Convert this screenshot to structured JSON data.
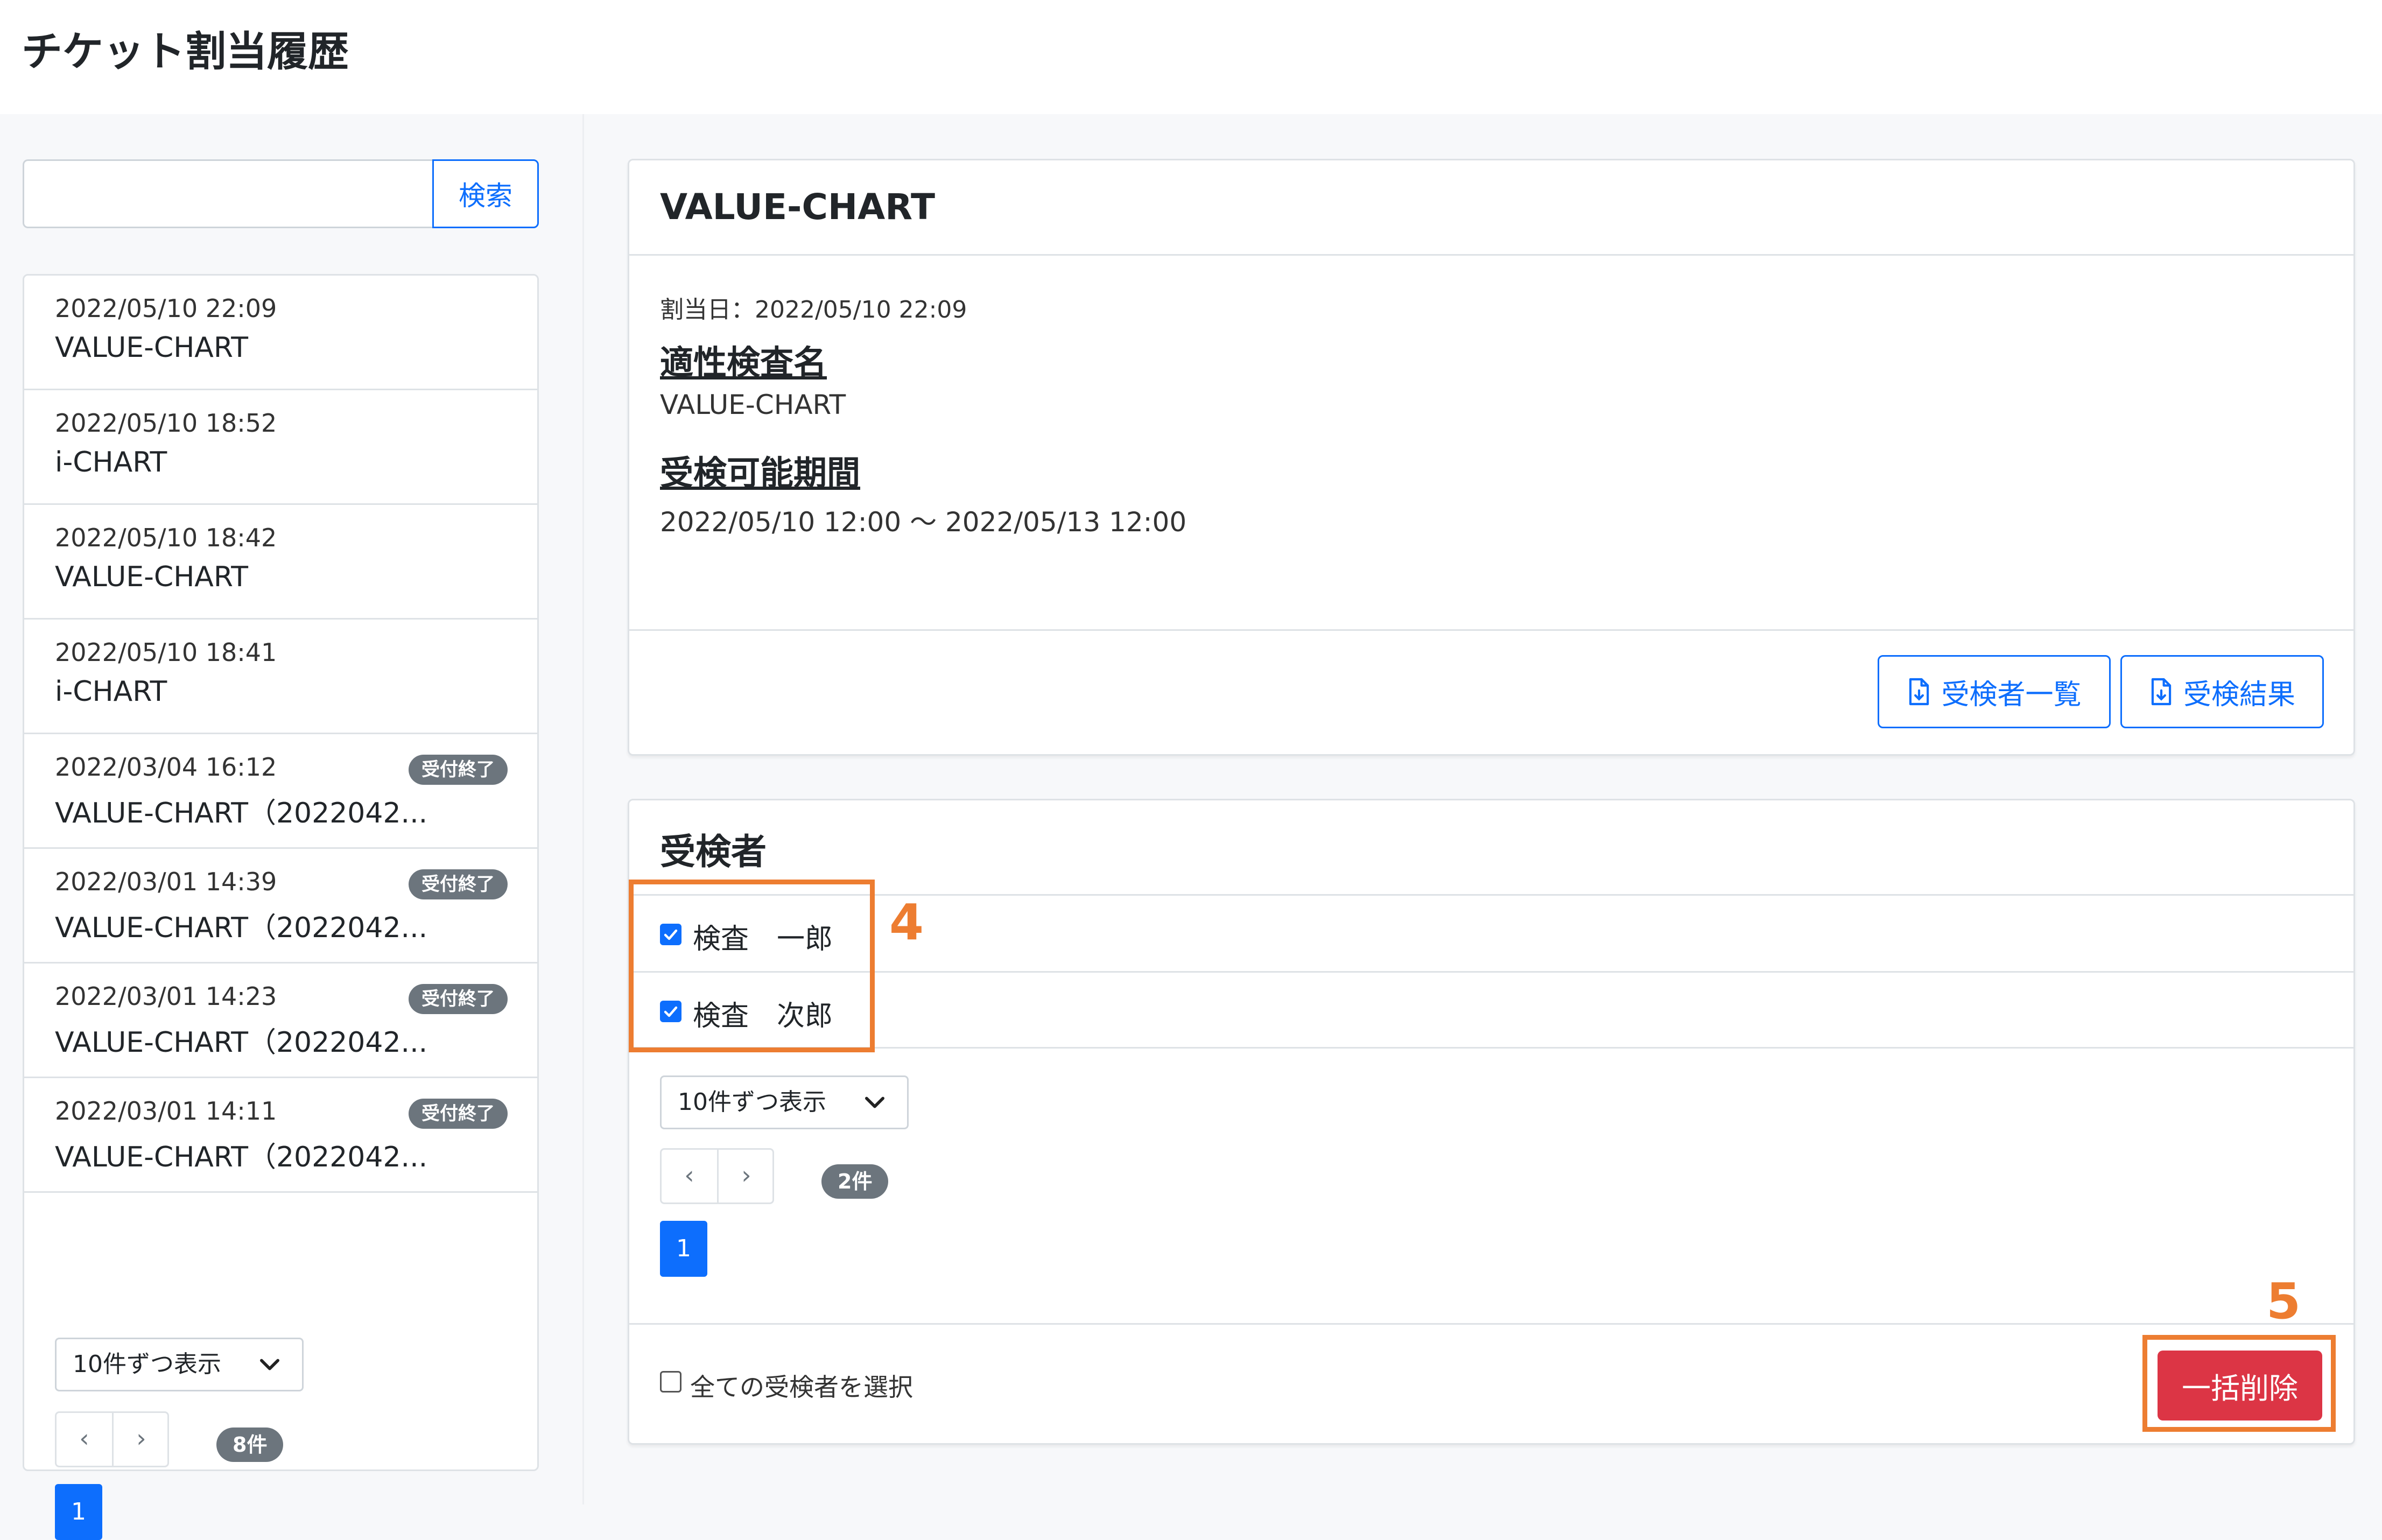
{
  "header": {
    "title": "チケット割当履歴"
  },
  "search": {
    "placeholder": "",
    "button_label": "検索"
  },
  "history_list": {
    "items": [
      {
        "date": "2022/05/10 22:09",
        "name": "VALUE-CHART",
        "badge": ""
      },
      {
        "date": "2022/05/10 18:52",
        "name": "i-CHART",
        "badge": ""
      },
      {
        "date": "2022/05/10 18:42",
        "name": "VALUE-CHART",
        "badge": ""
      },
      {
        "date": "2022/05/10 18:41",
        "name": "i-CHART",
        "badge": ""
      },
      {
        "date": "2022/03/04 16:12",
        "name": "VALUE-CHART（2022042...",
        "badge": "受付終了"
      },
      {
        "date": "2022/03/01 14:39",
        "name": "VALUE-CHART（2022042...",
        "badge": "受付終了"
      },
      {
        "date": "2022/03/01 14:23",
        "name": "VALUE-CHART（2022042...",
        "badge": "受付終了"
      },
      {
        "date": "2022/03/01 14:11",
        "name": "VALUE-CHART（2022042...",
        "badge": "受付終了"
      }
    ],
    "per_page_select": "10件ずつ表示",
    "prev": "‹",
    "next": "›",
    "count": "8件",
    "page": "1"
  },
  "detail": {
    "title": "VALUE-CHART",
    "assigned_date": "割当日：2022/05/10 22:09",
    "test_name_heading": "適性検査名",
    "test_name": "VALUE-CHART",
    "period_heading": "受検可能期間",
    "period": "2022/05/10 12:00 〜 2022/05/13 12:00",
    "btn_examinee_list": "受検者一覧",
    "btn_results": "受検結果"
  },
  "examinees": {
    "title": "受検者",
    "rows": [
      {
        "name": "検査　一郎",
        "checked": true
      },
      {
        "name": "検査　次郎",
        "checked": true
      }
    ],
    "per_page_select": "10件ずつ表示",
    "prev": "‹",
    "next": "›",
    "count": "2件",
    "page": "1",
    "select_all_label": "全ての受検者を選択",
    "bulk_delete_label": "一括削除"
  },
  "annotations": {
    "marker_4": "4",
    "marker_5": "5"
  },
  "colors": {
    "primary": "#0d6efd",
    "danger": "#dc3545",
    "annotation": "#ed7d31",
    "badge": "#6c757d"
  }
}
